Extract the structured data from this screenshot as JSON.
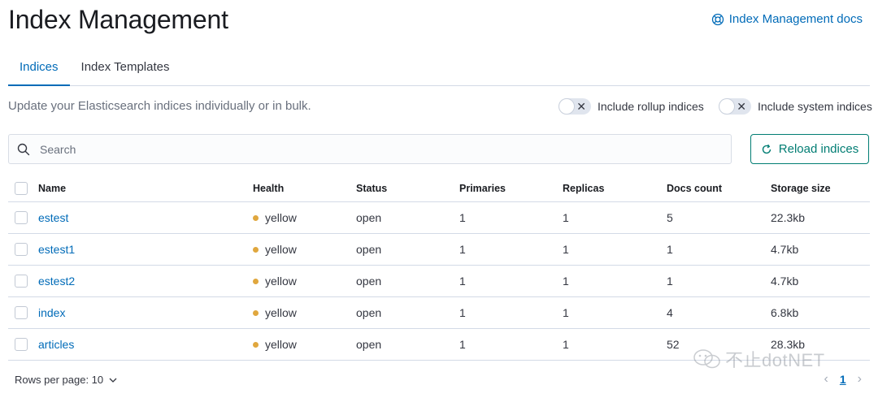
{
  "header": {
    "title": "Index Management",
    "docs_link": "Index Management docs"
  },
  "tabs": [
    {
      "label": "Indices",
      "active": true
    },
    {
      "label": "Index Templates",
      "active": false
    }
  ],
  "description": "Update your Elasticsearch indices individually or in bulk.",
  "toggles": {
    "rollup": {
      "label": "Include rollup indices",
      "on": false
    },
    "system": {
      "label": "Include system indices",
      "on": false
    }
  },
  "search": {
    "placeholder": "Search",
    "value": ""
  },
  "reload_button": "Reload indices",
  "table": {
    "columns": [
      "Name",
      "Health",
      "Status",
      "Primaries",
      "Replicas",
      "Docs count",
      "Storage size"
    ],
    "rows": [
      {
        "name": "estest",
        "health": "yellow",
        "status": "open",
        "primaries": "1",
        "replicas": "1",
        "docs": "5",
        "size": "22.3kb"
      },
      {
        "name": "estest1",
        "health": "yellow",
        "status": "open",
        "primaries": "1",
        "replicas": "1",
        "docs": "1",
        "size": "4.7kb"
      },
      {
        "name": "estest2",
        "health": "yellow",
        "status": "open",
        "primaries": "1",
        "replicas": "1",
        "docs": "1",
        "size": "4.7kb"
      },
      {
        "name": "index",
        "health": "yellow",
        "status": "open",
        "primaries": "1",
        "replicas": "1",
        "docs": "4",
        "size": "6.8kb"
      },
      {
        "name": "articles",
        "health": "yellow",
        "status": "open",
        "primaries": "1",
        "replicas": "1",
        "docs": "52",
        "size": "28.3kb"
      }
    ]
  },
  "pagination": {
    "rows_per_page": "Rows per page: 10",
    "current_page": "1"
  },
  "watermark": "不止dotNET",
  "colors": {
    "link": "#006bb8",
    "accent": "#017d73",
    "health_yellow": "#e0a73e"
  }
}
